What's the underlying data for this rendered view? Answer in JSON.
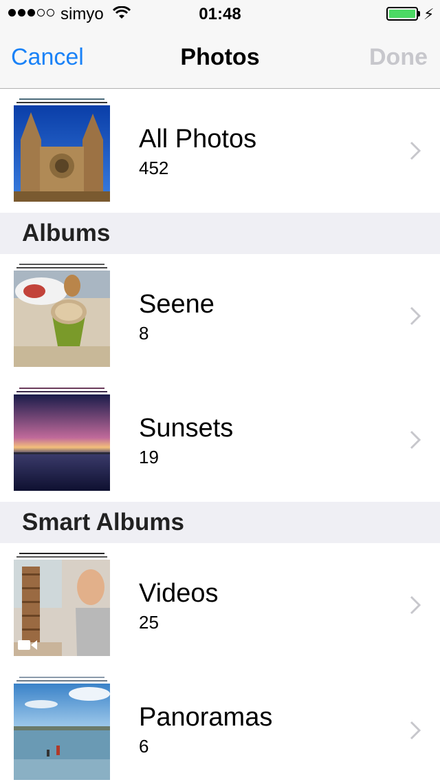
{
  "status_bar": {
    "carrier": "simyo",
    "time": "01:48",
    "battery_color": "#4cd964",
    "signal_bars_filled": 3,
    "signal_bars_total": 5
  },
  "nav": {
    "cancel_label": "Cancel",
    "title": "Photos",
    "done_label": "Done",
    "accent_color": "#1a82f7"
  },
  "all_photos": {
    "title": "All Photos",
    "count": "452"
  },
  "sections": {
    "albums": "Albums",
    "smart_albums": "Smart Albums"
  },
  "albums": [
    {
      "title": "Seene",
      "count": "8"
    },
    {
      "title": "Sunsets",
      "count": "19"
    }
  ],
  "smart_albums": [
    {
      "title": "Videos",
      "count": "25",
      "icon": "video-camera-icon"
    },
    {
      "title": "Panoramas",
      "count": "6"
    }
  ]
}
